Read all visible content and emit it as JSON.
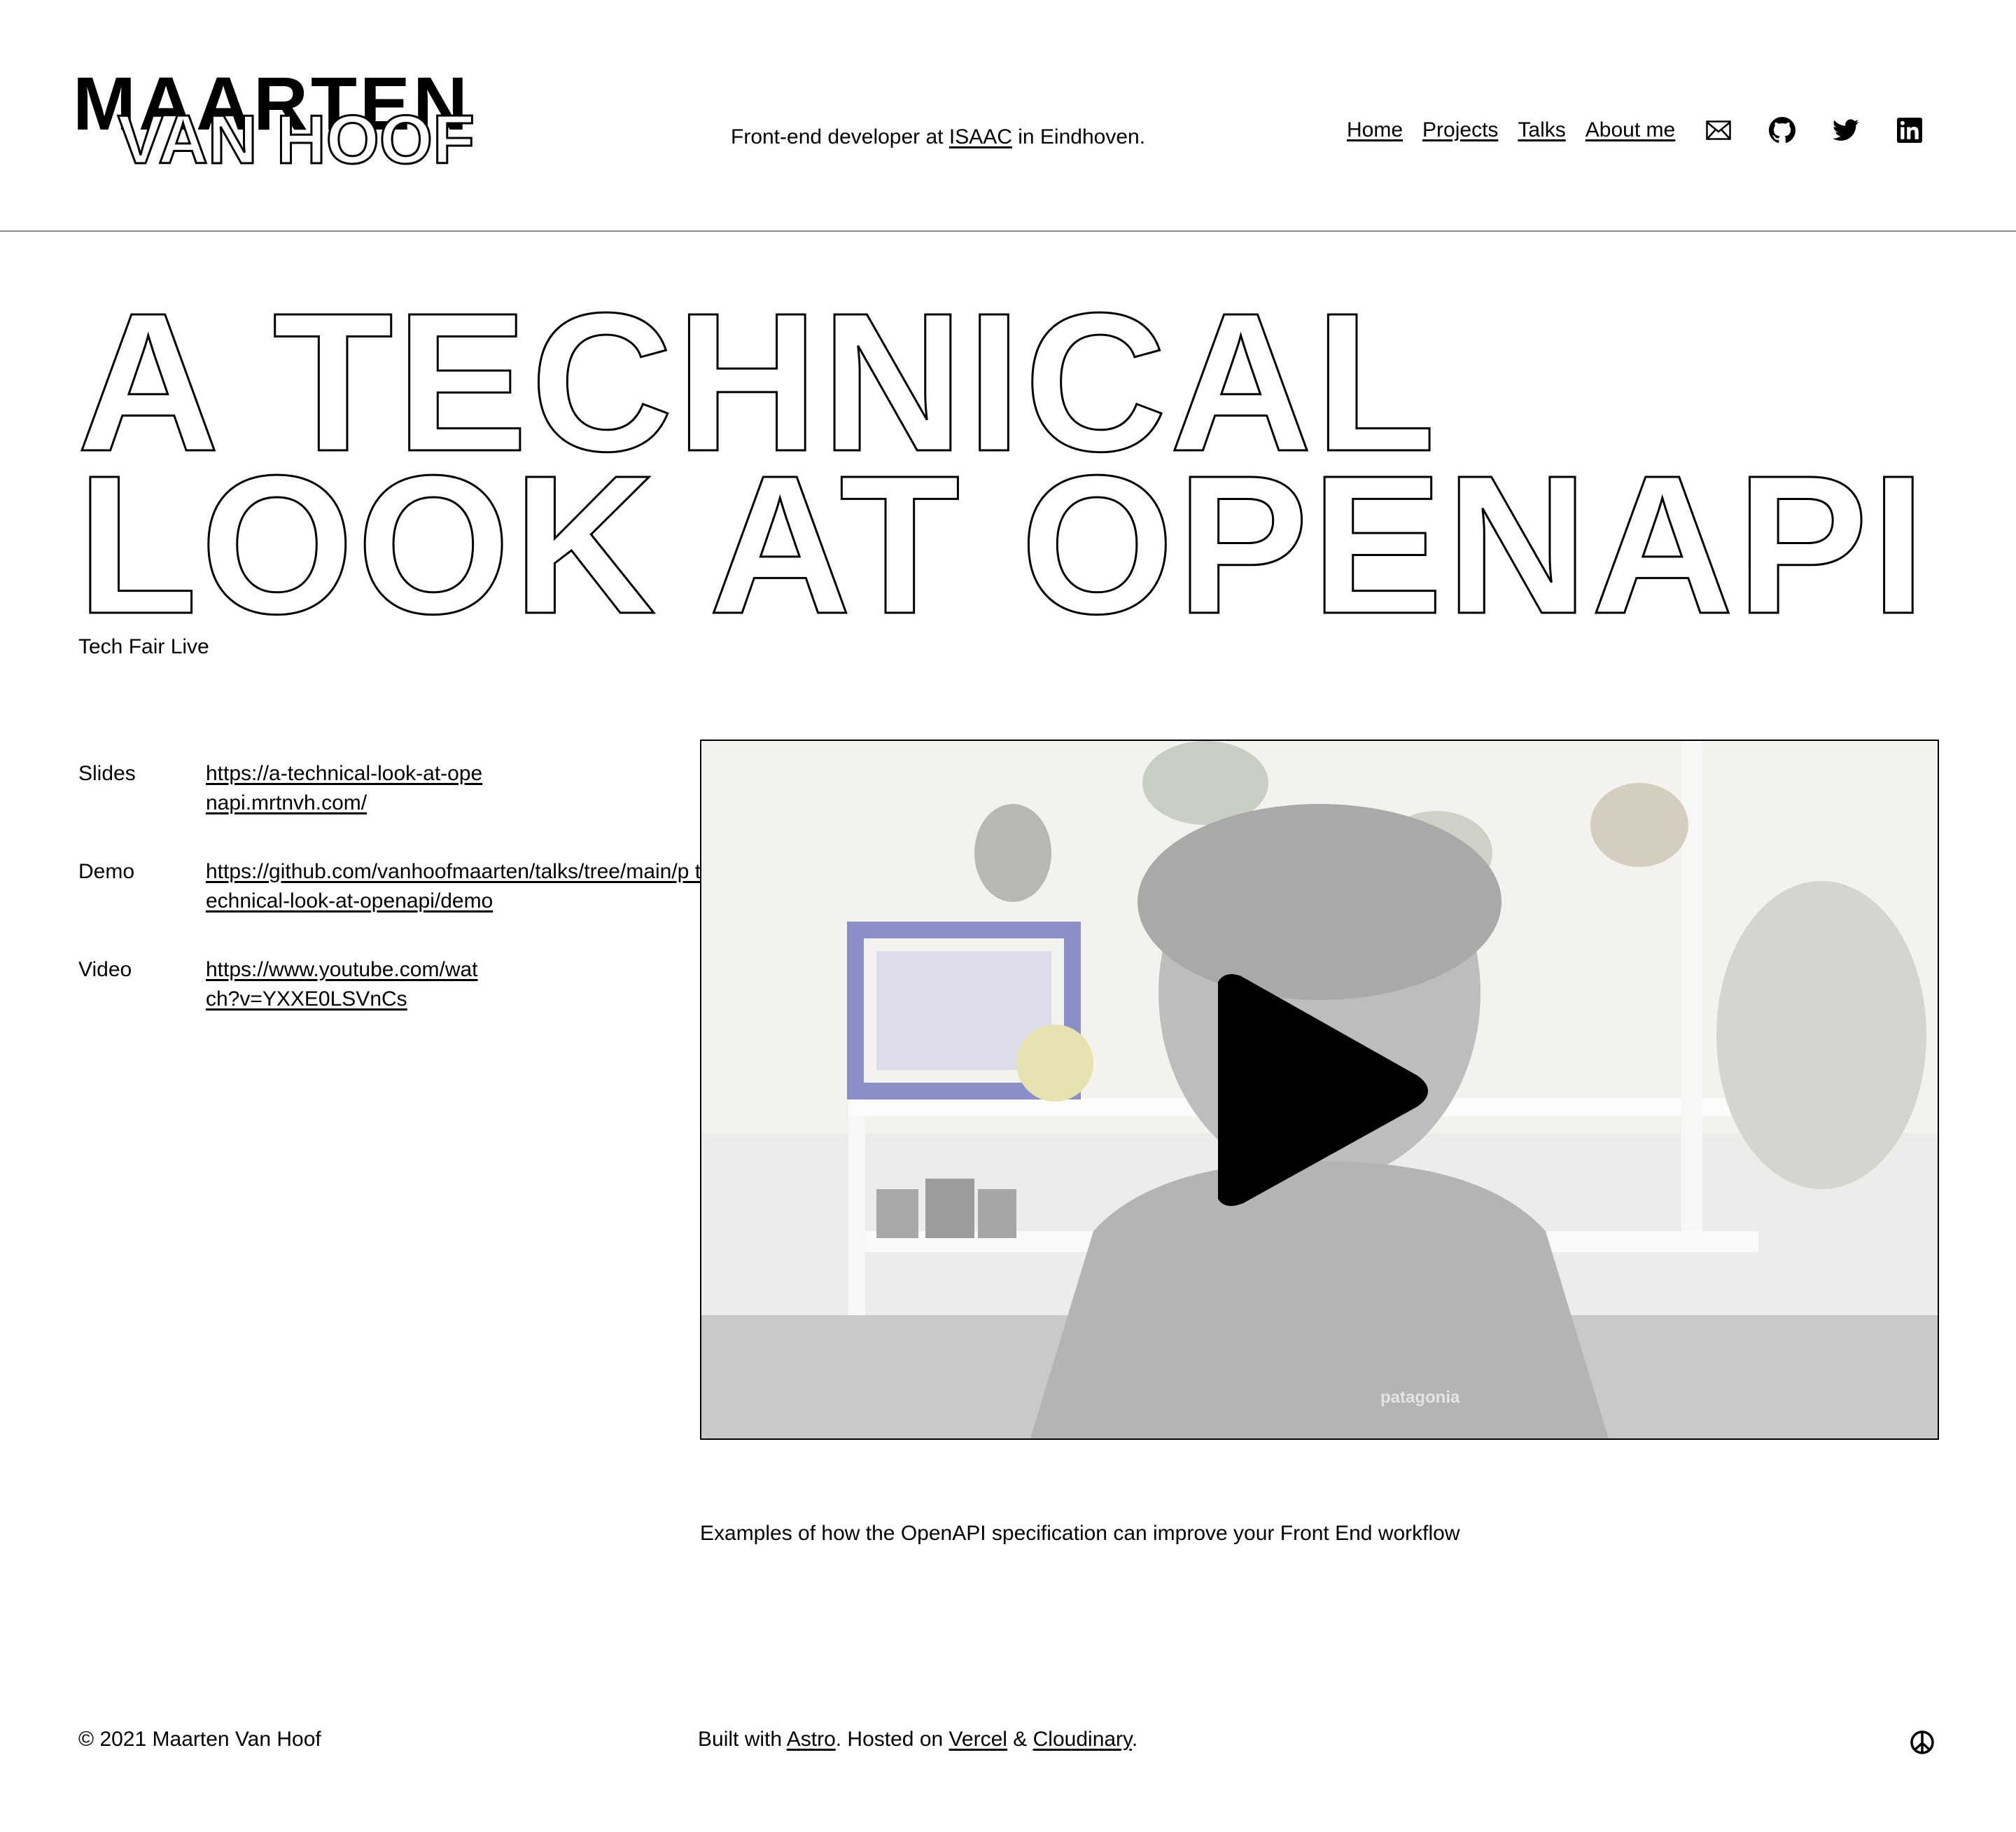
{
  "header": {
    "logo_line1": "MAARTEN",
    "logo_line2": "VAN HOOF",
    "tagline_prefix": "Front-end developer at",
    "tagline_link": "ISAAC",
    "tagline_suffix": "in Eindhoven.",
    "nav": [
      {
        "label": "Home"
      },
      {
        "label": "Projects"
      },
      {
        "label": "Talks"
      },
      {
        "label": "About me"
      }
    ],
    "social_icons": [
      "mail-icon",
      "github-icon",
      "twitter-icon",
      "linkedin-icon"
    ]
  },
  "talk": {
    "title_line1": "A TECHNICAL",
    "title_line2": "LOOK AT OPENAPI",
    "event": "Tech Fair Live",
    "links": [
      {
        "label": "Slides",
        "value": "https://a-technical-look-at-openapi.mrtnvh.com/"
      },
      {
        "label": "Demo",
        "value": "https://github.com/vanhoofmaarten/talks/tree/main/p technical-look-at-openapi/demo"
      },
      {
        "label": "Video",
        "value": "https://www.youtube.com/watch?v=YXXE0LSVnCs"
      }
    ],
    "video_shirt_text": "patagonia",
    "description": "Examples of how the OpenAPI specification can improve your Front End workflow"
  },
  "footer": {
    "copyright": "© 2021 Maarten Van Hoof",
    "built_prefix": "Built with",
    "built_link1": "Astro",
    "built_mid": ". Hosted on",
    "built_link2": "Vercel",
    "built_amp": "&",
    "built_link3": "Cloudinary",
    "built_end": ".",
    "peace_icon": "peace-icon"
  }
}
